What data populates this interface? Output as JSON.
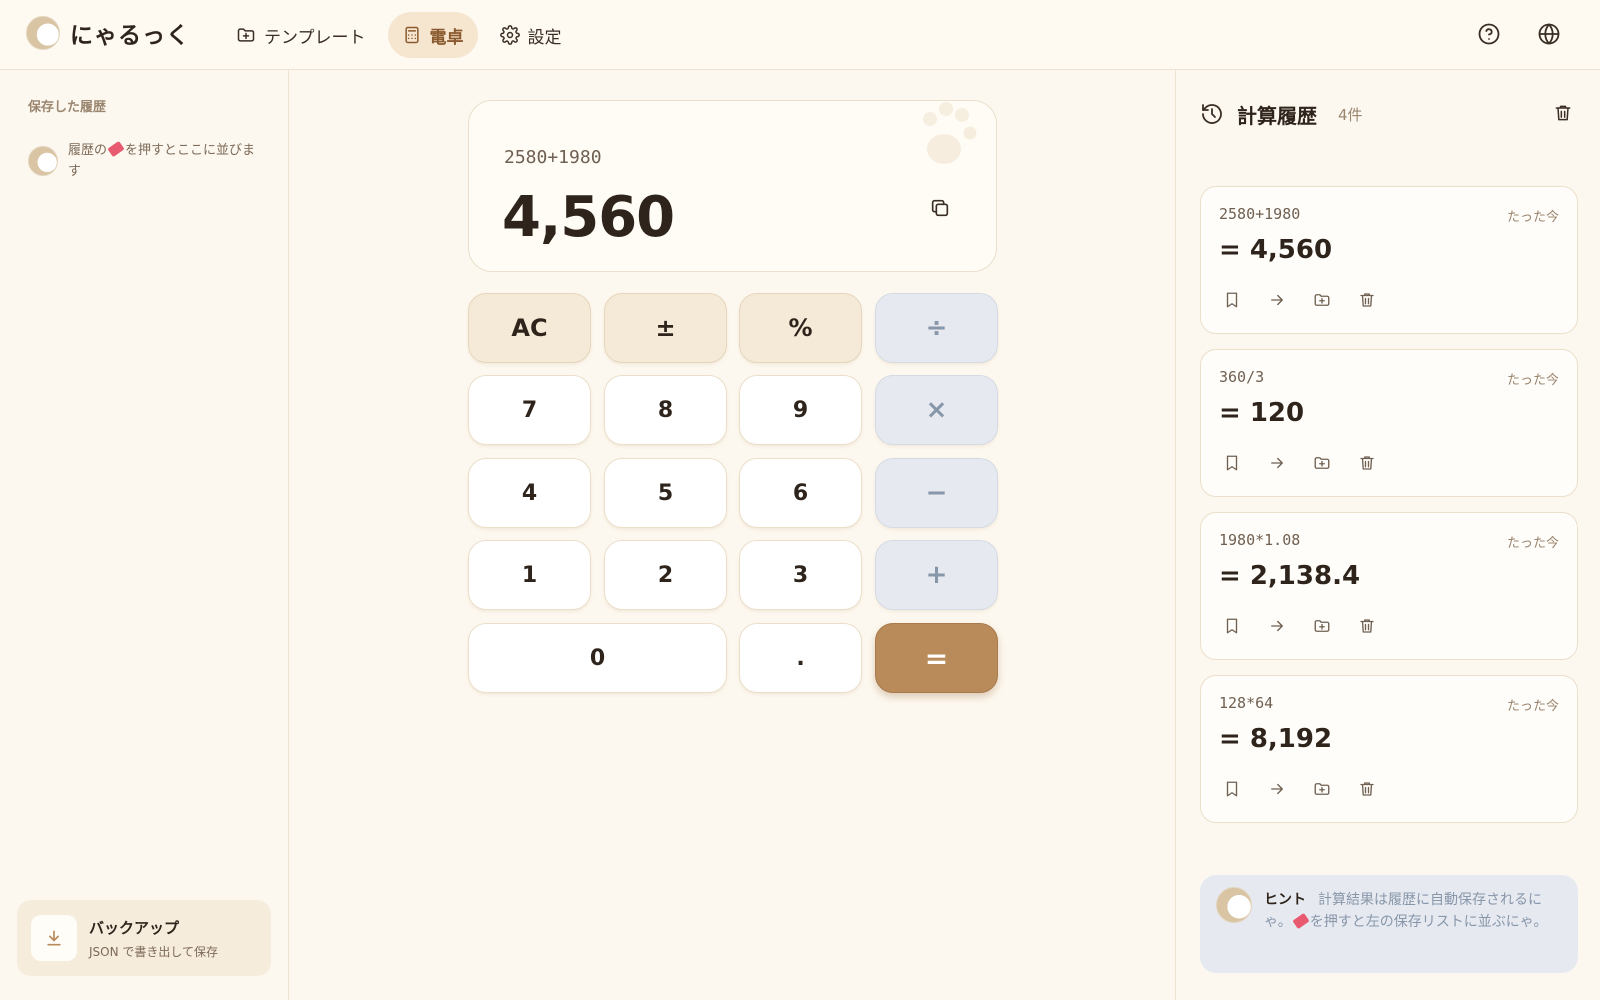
{
  "app": {
    "name": "にゃるっく"
  },
  "nav": [
    {
      "label": "テンプレート",
      "icon": "folder-plus-icon"
    },
    {
      "label": "電卓",
      "icon": "calculator-icon",
      "active": true
    },
    {
      "label": "設定",
      "icon": "gear-icon"
    }
  ],
  "header_icons": [
    "help-icon",
    "globe-icon"
  ],
  "left": {
    "title": "保存した履歴",
    "hint_before": "履歴の",
    "hint_after": "を押すとここに並びます",
    "backup_title": "バックアップ",
    "backup_sub": "JSON で書き出して保存"
  },
  "display": {
    "expression": "2580+1980",
    "value": "4,560"
  },
  "keypad": [
    "AC",
    "±",
    "%",
    "÷",
    "7",
    "8",
    "9",
    "×",
    "4",
    "5",
    "6",
    "−",
    "1",
    "2",
    "3",
    "+",
    "0",
    ".",
    "="
  ],
  "history": {
    "title": "計算履歴",
    "count": "4件",
    "items": [
      {
        "expr": "2580+1980",
        "result": "= 4,560",
        "time": "たった今"
      },
      {
        "expr": "360/3",
        "result": "= 120",
        "time": "たった今"
      },
      {
        "expr": "1980*1.08",
        "result": "= 2,138.4",
        "time": "たった今"
      },
      {
        "expr": "128*64",
        "result": "= 8,192",
        "time": "たった今"
      }
    ]
  },
  "hint": {
    "label": "ヒント",
    "before": "計算結果は履歴に自動保存されるにゃ。",
    "after": "を押すと左の保存リストに並ぶにゃ。"
  },
  "colors": {
    "accent": "#b98a5a",
    "background": "#fdf8ef",
    "operator": "#e6eaf0",
    "function": "#f5ead8"
  }
}
